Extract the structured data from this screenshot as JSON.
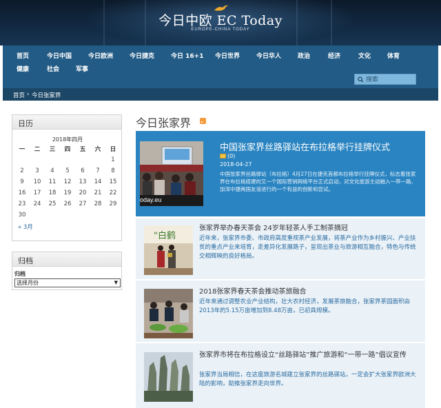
{
  "header": {
    "site_title": "今日中欧 EC Today",
    "site_subtitle": "EUROPE-CHINA TODAY"
  },
  "nav": {
    "items": [
      "首页",
      "今日中国",
      "今日欧洲",
      "今日捷克",
      "今日 16+1",
      "今日世界",
      "今日华人",
      "政治",
      "经济",
      "文化",
      "体育",
      "健康",
      "社会",
      "军事"
    ]
  },
  "breadcrumb": {
    "home": "首页",
    "separator": "›",
    "current": "今日张家界"
  },
  "search": {
    "placeholder": "搜索"
  },
  "calendar": {
    "title": "日历",
    "caption": "2018年四月",
    "weekdays": [
      "一",
      "二",
      "三",
      "四",
      "五",
      "六",
      "日"
    ],
    "weeks": [
      [
        "",
        "",
        "",
        "",
        "",
        "",
        "1"
      ],
      [
        "2",
        "3",
        "4",
        "5",
        "6",
        "7",
        "8"
      ],
      [
        "9",
        "10",
        "11",
        "12",
        "13",
        "14",
        "15"
      ],
      [
        "16",
        "17",
        "18",
        "19",
        "20",
        "21",
        "22"
      ],
      [
        "23",
        "24",
        "25",
        "26",
        "27",
        "28",
        "29"
      ],
      [
        "30",
        "",
        "",
        "",
        "",
        "",
        ""
      ]
    ],
    "prev_link": "« 3月"
  },
  "archive": {
    "title": "归档",
    "label": "归档",
    "select_value": "选择月份"
  },
  "main": {
    "title": "今日张家界"
  },
  "featured": {
    "title": "中国张家界丝路驿站在布拉格举行挂牌仪式",
    "comments": "(0)",
    "date": "2018-04-27",
    "summary": "中国张家界丝路驿站（布拉格）4月27日在捷克首都布拉格举行挂牌仪式，标志着张家界在布拉格搭建的又一个国际营销网络平台正式启动，对文化旅游主动融入一带一路、加深中捷两国友谊进行的一个有益的创新和尝试。",
    "image_caption": "oday.eu"
  },
  "articles": [
    {
      "title": "张家界举办春天茶会 24岁年轻茶人手工制茶摘冠",
      "summary": "近年来，张家界市委、市政府高度重视茶产业发展，将茶产业作为乡村振兴、产业扶贫的重点产业来培育，走差异化发展路子，呈现出茶业与旅游相互融合，特色与传统交相辉映的良好格局。"
    },
    {
      "title": "2018张家界春天茶会推动茶旅融合",
      "summary": "近年来通过调整农业产业结构，壮大农村经济，发展茶旅融合，张家界茶园面积由2013年的5.15万亩增加到8.48万亩，已初具规模。"
    },
    {
      "title": "张家界市将在布拉格设立“丝路驿站”推广旅游和“一带一路”倡议宣传",
      "summary": "张家界当局相信，在这座旅游名城建立张家界的丝路驿站，一定会扩大张家界欧洲大陆的影响，助推张家界走向世界。"
    }
  ],
  "colors": {
    "nav_bg": "#225b85",
    "breadcrumb_bg": "#1b4666",
    "featured_bg": "#2a84c1",
    "article_bg": "#eaf2f8",
    "summary_text": "#2a6a9e"
  }
}
